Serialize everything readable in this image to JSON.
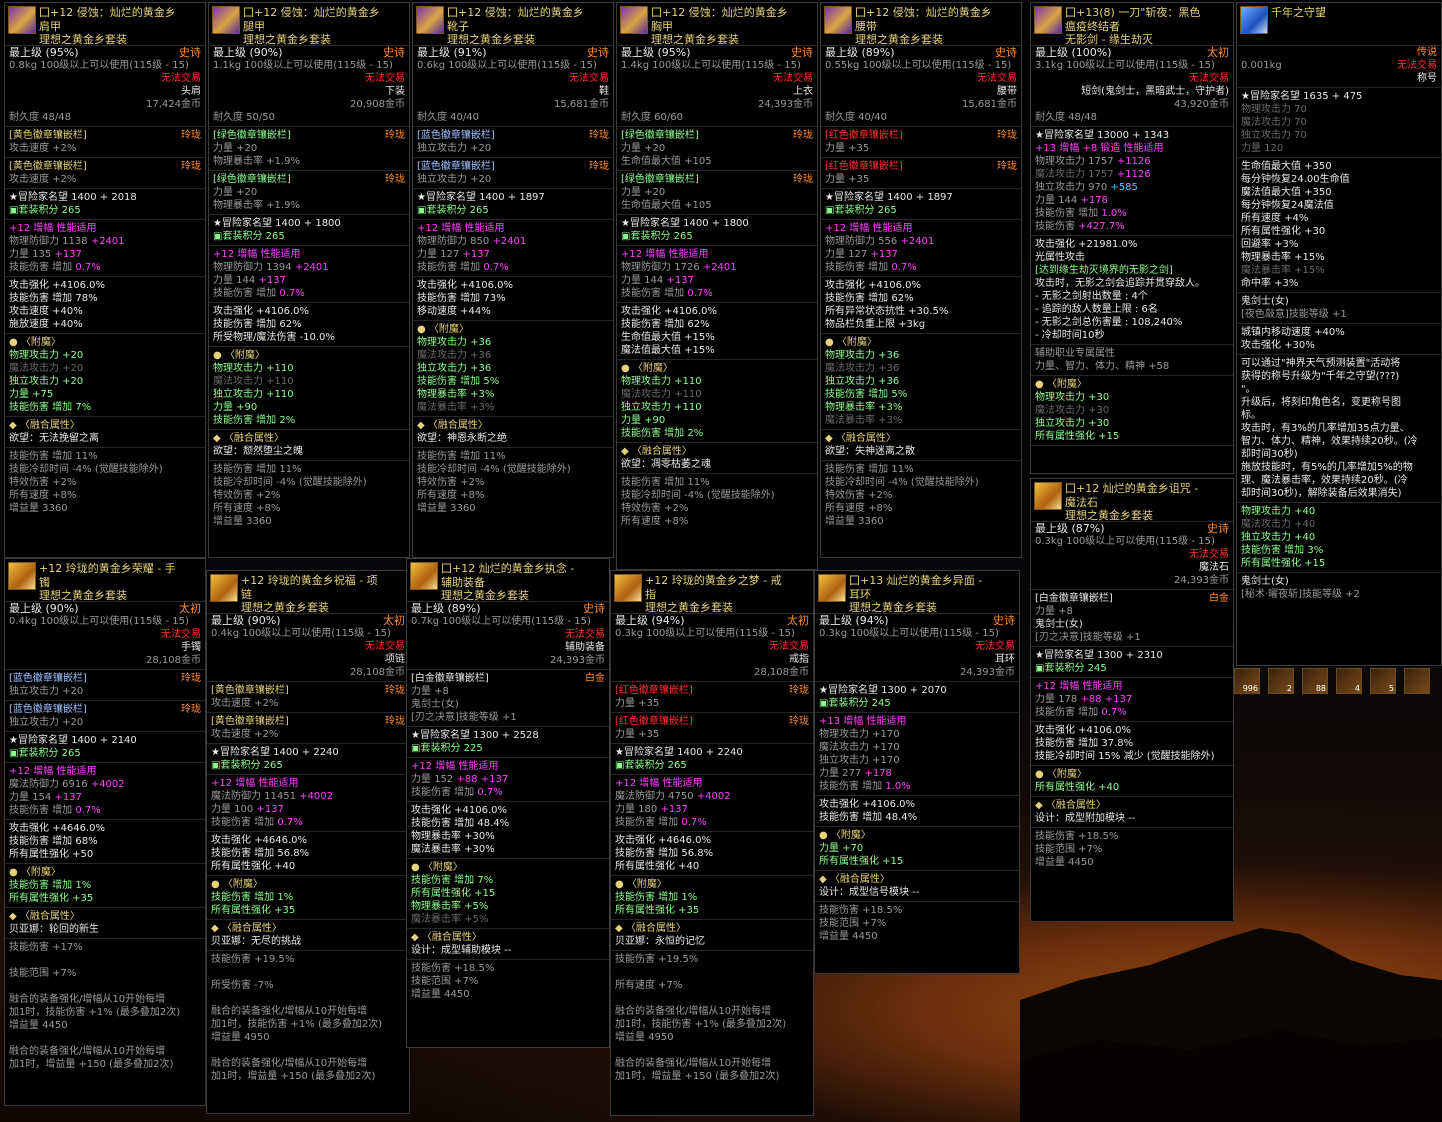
{
  "common": {
    "level_label": "最上级",
    "usage": "100级以上可以使用(115级 - 15)",
    "untradeable": "无法交易",
    "durability_label": "耐久度",
    "renown_label": "冒险家名望",
    "set_score_label": "套装积分",
    "enchant_label": "〈附魔〉",
    "fusion_label": "〈融合属性〉"
  },
  "cards": [
    {
      "name_lines": [
        "囗+12 侵蚀：灿烂的黄金乡",
        "肩甲",
        "理想之黄金乡套装"
      ],
      "grade": "(95%)",
      "rarity": "史诗",
      "weight": "0.8kg",
      "slot": "头肩",
      "price": "17,424金币",
      "durability": "48/48",
      "sockets": [
        {
          "name": "[黄色徽章镶嵌栏]",
          "right": "玲珑",
          "color": "y",
          "stat": "攻击速度 +2%"
        },
        {
          "name": "[黄色徽章镶嵌栏]",
          "right": "玲珑",
          "color": "y",
          "stat": "攻击速度 +2%"
        }
      ],
      "renown": "1400 + 2018",
      "set_score": "265",
      "amp_title": "+12 增幅 性能适用",
      "stats1": [
        "物理防御力 1138",
        "+2401",
        "力量 135",
        "+137",
        "技能伤害 增加",
        "0.7%"
      ],
      "stats2": [
        "攻击强化 +4106.0%",
        "技能伤害 增加 78%",
        "攻击速度 +40%",
        "施放速度 +40%"
      ],
      "enchant": [
        "物理攻击力 +20",
        "魔法攻击力 +20",
        "独立攻击力 +20",
        "力量 +75",
        "技能伤害 增加 7%"
      ],
      "fusion": "欲望：无法挽留之离",
      "fusion_stats": [
        "技能伤害 增加 11%",
        "技能冷却时间 -4% (觉醒技能除外)",
        "特效伤害 +2%",
        "所有速度 +8%",
        "增益量 3360"
      ]
    },
    {
      "name_lines": [
        "囗+12 侵蚀：灿烂的黄金乡",
        "腿甲",
        "理想之黄金乡套装"
      ],
      "grade": "(90%)",
      "rarity": "史诗",
      "weight": "1.1kg",
      "slot": "下装",
      "price": "20,908金币",
      "durability": "50/50",
      "sockets": [
        {
          "name": "[绿色徽章镶嵌栏]",
          "right": "玲珑",
          "color": "gr",
          "stat": "力量 +20",
          "stat2": "物理暴击率 +1.9%"
        },
        {
          "name": "[绿色徽章镶嵌栏]",
          "right": "玲珑",
          "color": "gr",
          "stat": "力量 +20",
          "stat2": "物理暴击率 +1.9%"
        }
      ],
      "renown": "1400 + 1800",
      "set_score": "265",
      "amp_title": "+12 增幅 性能适用",
      "stats1": [
        "物理防御力 1394",
        "+2401",
        "力量 144",
        "+137",
        "技能伤害 增加",
        "0.7%"
      ],
      "stats2": [
        "攻击强化 +4106.0%",
        "技能伤害 增加 62%",
        "所受物理/魔法伤害 -10.0%"
      ],
      "enchant": [
        "物理攻击力 +110",
        "魔法攻击力 +110",
        "独立攻击力 +110",
        "力量 +90",
        "技能伤害 增加 2%"
      ],
      "fusion": "欲望：颓然堕尘之魄",
      "fusion_stats": [
        "技能伤害 增加 11%",
        "技能冷却时间 -4% (觉醒技能除外)",
        "特效伤害 +2%",
        "所有速度 +8%",
        "增益量 3360"
      ]
    },
    {
      "name_lines": [
        "囗+12 侵蚀：灿烂的黄金乡",
        "靴子",
        "理想之黄金乡套装"
      ],
      "grade": "(91%)",
      "rarity": "史诗",
      "weight": "0.6kg",
      "slot": "鞋",
      "price": "15,681金币",
      "durability": "40/40",
      "sockets": [
        {
          "name": "[蓝色徽章镶嵌栏]",
          "right": "玲珑",
          "color": "lb",
          "stat": "独立攻击力 +20"
        },
        {
          "name": "[蓝色徽章镶嵌栏]",
          "right": "玲珑",
          "color": "lb",
          "stat": "独立攻击力 +20"
        }
      ],
      "renown": "1400 + 1897",
      "set_score": "265",
      "amp_title": "+12 增幅 性能适用",
      "stats1": [
        "物理防御力 850",
        "+2401",
        "力量 127",
        "+137",
        "技能伤害 增加",
        "0.7%"
      ],
      "stats2": [
        "攻击强化 +4106.0%",
        "技能伤害 增加 73%",
        "移动速度 +44%"
      ],
      "enchant": [
        "物理攻击力 +36",
        "魔法攻击力 +36",
        "独立攻击力 +36",
        "技能伤害 增加 5%",
        "物理暴击率 +3%",
        "魔法暴击率 +3%"
      ],
      "fusion": "欲望：神恩永断之绝",
      "fusion_stats": [
        "技能伤害 增加 11%",
        "技能冷却时间 -4% (觉醒技能除外)",
        "特效伤害 +2%",
        "所有速度 +8%",
        "增益量 3360"
      ]
    },
    {
      "name_lines": [
        "囗+12 侵蚀：灿烂的黄金乡",
        "胸甲",
        "理想之黄金乡套装"
      ],
      "grade": "(95%)",
      "rarity": "史诗",
      "weight": "1.4kg",
      "slot": "上衣",
      "price": "24,393金币",
      "durability": "60/60",
      "sockets": [
        {
          "name": "[绿色徽章镶嵌栏]",
          "right": "玲珑",
          "color": "gr",
          "stat": "力量 +20",
          "stat2": "生命值最大值 +105"
        },
        {
          "name": "[绿色徽章镶嵌栏]",
          "right": "玲珑",
          "color": "gr",
          "stat": "力量 +20",
          "stat2": "生命值最大值 +105"
        }
      ],
      "renown": "1400 + 1800",
      "set_score": "265",
      "amp_title": "+12 增幅 性能适用",
      "stats1": [
        "物理防御力 1726",
        "+2401",
        "力量 144",
        "+137",
        "技能伤害 增加",
        "0.7%"
      ],
      "stats2": [
        "攻击强化 +4106.0%",
        "技能伤害 增加 62%",
        "生命值最大值 +15%",
        "魔法值最大值 +15%"
      ],
      "enchant": [
        "物理攻击力 +110",
        "魔法攻击力 +110",
        "独立攻击力 +110",
        "力量 +90",
        "技能伤害 增加 2%"
      ],
      "fusion": "欲望：凋零枯萎之魂",
      "fusion_stats": [
        "技能伤害 增加 11%",
        "技能冷却时间 -4% (觉醒技能除外)",
        "特效伤害 +2%",
        "所有速度 +8%"
      ]
    },
    {
      "name_lines": [
        "囗+12 侵蚀：灿烂的黄金乡",
        "腰带",
        "理想之黄金乡套装"
      ],
      "grade": "(89%)",
      "rarity": "史诗",
      "weight": "0.55kg",
      "slot": "腰带",
      "price": "15,681金币",
      "durability": "40/40",
      "sockets": [
        {
          "name": "[红色徽章镶嵌栏]",
          "right": "玲珑",
          "color": "red",
          "stat": "力量 +35"
        },
        {
          "name": "[红色徽章镶嵌栏]",
          "right": "玲珑",
          "color": "red",
          "stat": "力量 +35"
        }
      ],
      "renown": "1400 + 1897",
      "set_score": "265",
      "amp_title": "+12 增幅 性能适用",
      "stats1": [
        "物理防御力 556",
        "+2401",
        "力量 127",
        "+137",
        "技能伤害 增加",
        "0.7%"
      ],
      "stats2": [
        "攻击强化 +4106.0%",
        "技能伤害 增加 62%",
        "所有异常状态抗性 +30.5%",
        "物品栏负重上限 +3kg"
      ],
      "enchant": [
        "物理攻击力 +36",
        "魔法攻击力 +36",
        "独立攻击力 +36",
        "技能伤害 增加 5%",
        "物理暴击率 +3%",
        "魔法暴击率 +3%"
      ],
      "fusion": "欲望：失神迷离之散",
      "fusion_stats": [
        "技能伤害 增加 11%",
        "技能冷却时间 -4% (觉醒技能除外)",
        "特效伤害 +2%",
        "所有速度 +8%",
        "增益量 3360"
      ]
    }
  ],
  "weapon": {
    "name_lines": [
      "囗+13(8) 一刀\"斩夜：黑色",
      "瘟疫终结者",
      "无影剑 - 缘生劫灭"
    ],
    "grade": "(100%)",
    "rarity": "太初",
    "weight": "3.1kg",
    "slot": "短剑(鬼剑士，黑暗武士，守护者)",
    "price": "43,920金币",
    "durability": "48/48",
    "renown": "13000 + 1343",
    "amp_title": "+13 增幅 +8 锻造 性能适用",
    "atk": [
      {
        "l": "物理攻击力 1757",
        "v": "+1126"
      },
      {
        "l": "魔法攻击力 1757",
        "v": "+1126"
      },
      {
        "l": "独立攻击力 970",
        "v": "+585"
      },
      {
        "l": "力量 144",
        "v": "+178"
      },
      {
        "l": "技能伤害 增加",
        "v": "1.0%"
      },
      {
        "l": "技能伤害",
        "v": "+427.7%"
      }
    ],
    "atk_strength": "攻击强化 +21981.0%",
    "light": "光属性攻击",
    "cond": "[达到缘生劫灭境界的无影之剑]",
    "desc": "攻击时，无影之剑会追踪并贯穿敌人。",
    "bullets": [
      "- 无影之剑射出数量 : 4个",
      "- 追踪的敌人数量上限 : 6名",
      "- 无影之剑总伤害量 : 108,240%",
      "- 冷却时间10秒"
    ],
    "aux1": "辅助职业专属属性",
    "aux2": "力量、智力、体力、精神 +58",
    "enchant": [
      "物理攻击力 +30",
      "魔法攻击力 +30",
      "独立攻击力 +30",
      "所有属性强化 +15"
    ]
  },
  "title_card": {
    "name": "千年之守望",
    "weight": "0.001kg",
    "rarity": "传说",
    "untradeable": "无法交易",
    "slot": "称号",
    "renown": "1635 + 475",
    "stats_dim": [
      "物理攻击力 70",
      "魔法攻击力 70",
      "独立攻击力 70",
      "力量 120"
    ],
    "stats": [
      "生命值最大值 +350",
      "每分钟恢复24.00生命值",
      "魔法值最大值 +350",
      "每分钟恢复24魔法值",
      "所有速度 +4%",
      "所有属性强化 +30",
      "回避率 +3%",
      "物理暴击率 +15%",
      "魔法暴击率 +15%",
      "命中率 +3%"
    ],
    "class1": "鬼剑士(女)",
    "class1b": "[夜色敲意]技能等级 +1",
    "town": "城镇内移动速度 +40%",
    "atkstr": "攻击强化 +30%",
    "desc1": "可以通过\"神界天气预测装置\"活动将",
    "desc2": "获得的称号升级为\"千年之守望(???)",
    "desc3": "\"。",
    "desc4": "升级后，将刻印角色名，变更称号图",
    "desc5": "标。",
    "desc6": "攻击时，有3%的几率增加35点力量、",
    "desc7": "智力、体力、精神，效果持续20秒。(冷",
    "desc8": "却时间30秒)",
    "desc9": "施放技能时，有5%的几率增加5%的物",
    "desc10": "理、魔法暴击率，效果持续20秒。(冷",
    "desc11": "却时间30秒)，解除装备后效果消失)",
    "enc": [
      "物理攻击力 +40",
      "魔法攻击力 +40",
      "独立攻击力 +40",
      "技能伤害 增加 3%",
      "所有属性强化 +15"
    ],
    "class2": "鬼剑士(女)",
    "class2b": "[秘术·曜夜斩]技能等级 +2"
  },
  "magicstone": {
    "name_lines": [
      "囗+12 灿烂的黄金乡诅咒 -",
      "魔法石",
      "理想之黄金乡套装"
    ],
    "grade": "(87%)",
    "rarity": "史诗",
    "weight": "0.3kg",
    "slot": "魔法石",
    "price": "24,393金币",
    "socket": "[白金徽章镶嵌栏]",
    "socket_r": "白金",
    "socket_stat": "力量 +8",
    "cls": "鬼剑士(女)",
    "cls2": "[刃之决意]技能等级 +1",
    "renown": "1300 + 2310",
    "set_score": "245",
    "amp": "+12 增幅 性能适用",
    "s1": [
      "力量 178",
      "+88 +137",
      "技能伤害 增加",
      "0.7%"
    ],
    "s2": [
      "攻击强化 +4106.0%",
      "技能伤害 增加 37.8%",
      "技能冷却时间 15% 减少 (觉醒技能除外)"
    ],
    "enc": "所有属性强化 +40",
    "fusion": "设计：成型附加模块 --",
    "fstats": [
      "技能伤害 +18.5%",
      "技能范围 +7%",
      "增益量 4450"
    ]
  },
  "row2": [
    {
      "name_lines": [
        "+12 玲珑的黄金乡荣耀 - 手",
        "镯",
        "理想之黄金乡套装"
      ],
      "grade": "(90%)",
      "rarity": "太初",
      "weight": "0.4kg",
      "slot": "手镯",
      "price": "28,108金币",
      "sockets": [
        {
          "name": "[蓝色徽章镶嵌栏]",
          "right": "玲珑",
          "color": "lb",
          "stat": "独立攻击力 +20"
        },
        {
          "name": "[蓝色徽章镶嵌栏]",
          "right": "玲珑",
          "color": "lb",
          "stat": "独立攻击力 +20"
        }
      ],
      "renown": "1400 + 2140",
      "set_score": "265",
      "amp_title": "+12 增幅 性能适用",
      "stats1": [
        "魔法防御力 6916",
        "+4002",
        "力量 154",
        "+137",
        "技能伤害 增加",
        "0.7%"
      ],
      "stats2": [
        "攻击强化 +4646.0%",
        "技能伤害 增加 68%",
        "所有属性强化 +50"
      ],
      "enchant": [
        "技能伤害 增加 1%",
        "所有属性强化 +35"
      ],
      "fusion": "贝亚娜：轮回的新生",
      "fusion_stats": [
        "技能伤害 +17%",
        "",
        "技能范围 +7%",
        "",
        "融合的装备强化/增幅从10开始每增",
        "加1时，技能伤害 +1% (最多叠加2次)",
        "增益量 4450",
        "",
        "融合的装备强化/增幅从10开始每增",
        "加1时，增益量 +150 (最多叠加2次)"
      ]
    },
    {
      "name_lines": [
        "+12 玲珑的黄金乡祝福 - 项",
        "链",
        "理想之黄金乡套装"
      ],
      "grade": "(90%)",
      "rarity": "太初",
      "weight": "0.4kg",
      "slot": "项链",
      "price": "28,108金币",
      "sockets": [
        {
          "name": "[黄色徽章镶嵌栏]",
          "right": "玲珑",
          "color": "y",
          "stat": "攻击速度 +2%"
        },
        {
          "name": "[黄色徽章镶嵌栏]",
          "right": "玲珑",
          "color": "y",
          "stat": "攻击速度 +2%"
        }
      ],
      "renown": "1400 + 2240",
      "set_score": "265",
      "amp_title": "+12 增幅 性能适用",
      "stats1": [
        "魔法防御力 11451",
        "+4002",
        "力量 100",
        "+137",
        "技能伤害 增加",
        "0.7%"
      ],
      "stats2": [
        "攻击强化 +4646.0%",
        "技能伤害 增加 56.8%",
        "所有属性强化 +40"
      ],
      "enchant": [
        "技能伤害 增加 1%",
        "所有属性强化 +35"
      ],
      "fusion": "贝亚娜：无尽的挑战",
      "fusion_stats": [
        "技能伤害 +19.5%",
        "",
        "所受伤害 -7%",
        "",
        "融合的装备强化/增幅从10开始每增",
        "加1时，技能伤害 +1% (最多叠加2次)",
        "增益量 4950",
        "",
        "融合的装备强化/增幅从10开始每增",
        "加1时，增益量 +150 (最多叠加2次)"
      ]
    },
    {
      "name_lines": [
        "囗+12 灿烂的黄金乡执念 -",
        "辅助装备",
        "理想之黄金乡套装"
      ],
      "grade": "(89%)",
      "rarity": "史诗",
      "weight": "0.7kg",
      "slot": "辅助装备",
      "price": "24,393金币",
      "sockets": [
        {
          "name": "[白金徽章镶嵌栏]",
          "right": "白金",
          "color": "w",
          "stat": "力量 +8",
          "stat2": "鬼剑士(女)",
          "stat3": "[刃之决意]技能等级 +1"
        }
      ],
      "renown": "1300 + 2528",
      "set_score": "225",
      "amp_title": "+12 增幅 性能适用",
      "stats1": [
        "力量 152",
        "+88 +137",
        "技能伤害 增加",
        "0.7%"
      ],
      "stats2": [
        "攻击强化 +4106.0%",
        "技能伤害 增加 48.4%",
        "物理暴击率 +30%",
        "魔法暴击率 +30%"
      ],
      "enchant": [
        "技能伤害 增加 7%",
        "所有属性强化 +15",
        "物理暴击率 +5%",
        "魔法暴击率 +5%"
      ],
      "fusion": "设计：成型辅助模块 --",
      "fusion_stats": [
        "技能伤害 +18.5%",
        "技能范围 +7%",
        "增益量 4450"
      ]
    },
    {
      "name_lines": [
        "+12 玲珑的黄金乡之梦 - 戒",
        "指",
        "理想之黄金乡套装"
      ],
      "grade": "(94%)",
      "rarity": "太初",
      "weight": "0.3kg",
      "slot": "戒指",
      "price": "28,108金币",
      "sockets": [
        {
          "name": "[红色徽章镶嵌栏]",
          "right": "玲珑",
          "color": "red",
          "stat": "力量 +35"
        },
        {
          "name": "[红色徽章镶嵌栏]",
          "right": "玲珑",
          "color": "red",
          "stat": "力量 +35"
        }
      ],
      "renown": "1400 + 2240",
      "set_score": "265",
      "amp_title": "+12 增幅 性能适用",
      "stats1": [
        "魔法防御力 4750",
        "+4002",
        "力量 180",
        "+137",
        "技能伤害 增加",
        "0.7%"
      ],
      "stats2": [
        "攻击强化 +4646.0%",
        "技能伤害 增加 56.8%",
        "所有属性强化 +40"
      ],
      "enchant": [
        "技能伤害 增加 1%",
        "所有属性强化 +35"
      ],
      "fusion": "贝亚娜：永恒的记忆",
      "fusion_stats": [
        "技能伤害 +19.5%",
        "",
        "所有速度 +7%",
        "",
        "融合的装备强化/增幅从10开始每增",
        "加1时，技能伤害 +1% (最多叠加2次)",
        "增益量 4950",
        "",
        "融合的装备强化/增幅从10开始每增",
        "加1时，增益量 +150 (最多叠加2次)"
      ]
    },
    {
      "name_lines": [
        "囗+13 灿烂的黄金乡异面 -",
        "耳环",
        "理想之黄金乡套装"
      ],
      "grade": "(94%)",
      "rarity": "史诗",
      "weight": "0.3kg",
      "slot": "耳环",
      "price": "24,393金币",
      "sockets": [],
      "renown": "1300 + 2070",
      "set_score": "245",
      "amp_title": "+13 增幅 性能适用",
      "stats1": [
        "物理攻击力 +170",
        "",
        "魔法攻击力 +170",
        "",
        "独立攻击力 +170",
        "",
        "力量 277",
        "+178",
        "技能伤害 增加",
        "1.0%"
      ],
      "stats2": [
        "攻击强化 +4106.0%",
        "技能伤害 增加 48.4%"
      ],
      "enchant": [
        "力量 +70",
        "所有属性强化 +15"
      ],
      "fusion": "设计：成型信号模块 --",
      "fusion_stats": [
        "技能伤害 +18.5%",
        "技能范围 +7%",
        "增益量 4450"
      ]
    }
  ],
  "quickbar": [
    "996",
    "2",
    "88",
    "4",
    "5",
    ""
  ]
}
